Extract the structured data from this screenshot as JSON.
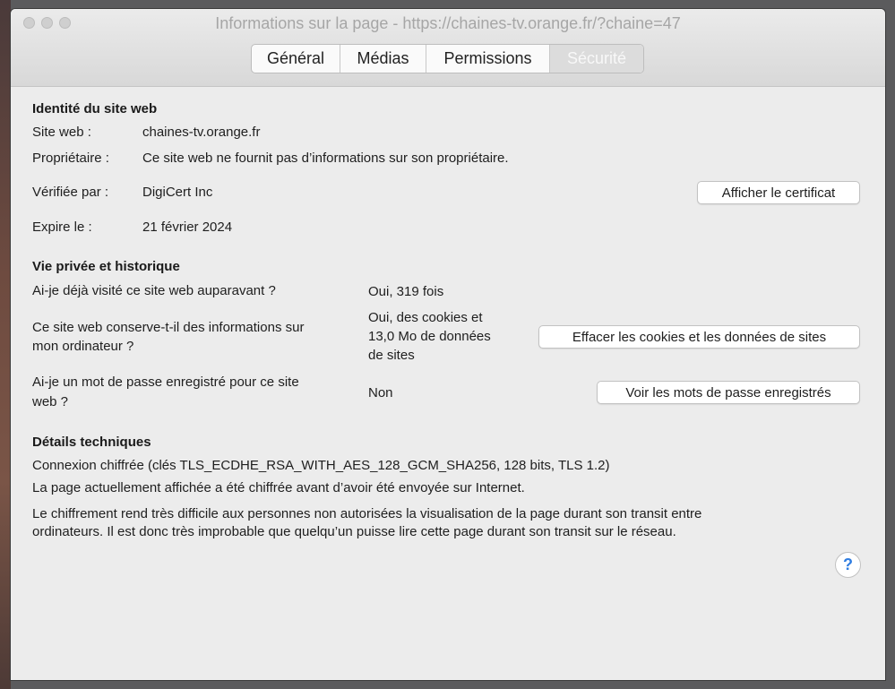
{
  "window": {
    "title": "Informations sur la page - https://chaines-tv.orange.fr/?chaine=47"
  },
  "tabs": [
    {
      "label": "Général",
      "active": false
    },
    {
      "label": "Médias",
      "active": false
    },
    {
      "label": "Permissions",
      "active": false
    },
    {
      "label": "Sécurité",
      "active": true
    }
  ],
  "identity": {
    "heading": "Identité du site web",
    "site_label": "Site web :",
    "site_value": "chaines-tv.orange.fr",
    "owner_label": "Propriétaire :",
    "owner_value": "Ce site web ne fournit pas d’informations sur son propriétaire.",
    "verified_label": "Vérifiée par :",
    "verified_value": "DigiCert Inc",
    "expires_label": "Expire le :",
    "expires_value": "21 février 2024",
    "certificate_button": "Afficher le certificat"
  },
  "privacy": {
    "heading": "Vie privée et historique",
    "visited_question": "Ai-je déjà visité ce site web auparavant ?",
    "visited_answer": "Oui, 319 fois",
    "storage_question_line1": "Ce site web conserve-t-il des informations sur",
    "storage_question_line2": "mon ordinateur ?",
    "storage_answer_line1": "Oui, des cookies et",
    "storage_answer_line2": "13,0 Mo de données",
    "storage_answer_line3": "de sites",
    "clear_button": "Effacer les cookies et les données de sites",
    "password_question_line1": "Ai-je un mot de passe enregistré pour ce site",
    "password_question_line2": "web ?",
    "password_answer": "Non",
    "passwords_button": "Voir les mots de passe enregistrés"
  },
  "technical": {
    "heading": "Détails techniques",
    "connection": "Connexion chiffrée (clés TLS_ECDHE_RSA_WITH_AES_128_GCM_SHA256, 128 bits, TLS 1.2)",
    "encrypted_note": "La page actuellement affichée a été chiffrée avant d’avoir été envoyée sur Internet.",
    "explanation_line1": "Le chiffrement rend très difficile aux personnes non autorisées la visualisation de la page durant son transit entre",
    "explanation_line2": "ordinateurs. Il est donc très improbable que quelqu’un puisse lire cette page durant son transit sur le réseau."
  },
  "help_button": "?",
  "colors": {
    "accent": "#2f7de1",
    "window_bg": "#ececec"
  }
}
